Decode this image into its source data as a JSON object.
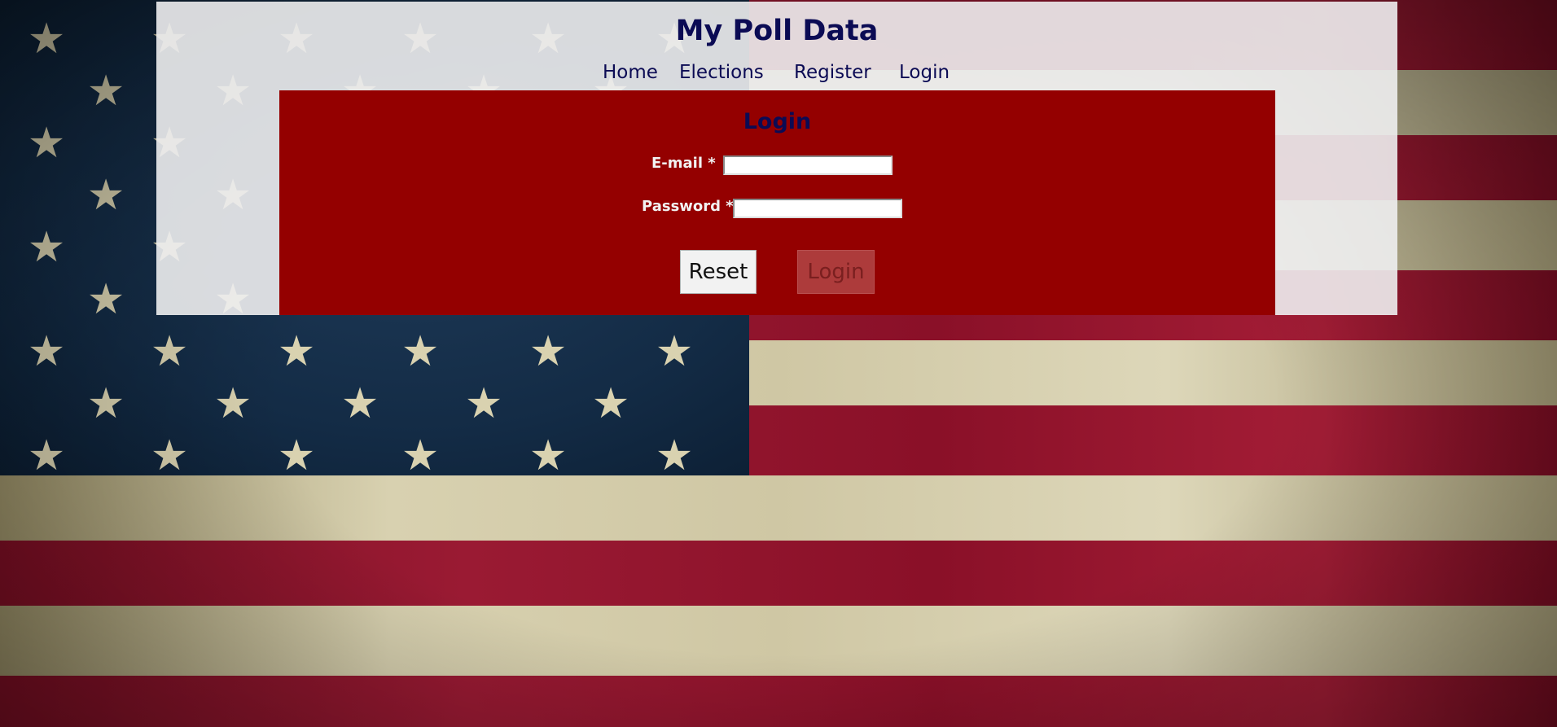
{
  "site": {
    "title": "My Poll Data"
  },
  "nav": {
    "items": [
      {
        "label": "Home"
      },
      {
        "label": "Elections"
      },
      {
        "label": "Register"
      },
      {
        "label": "Login"
      }
    ]
  },
  "login_form": {
    "title": "Login",
    "email": {
      "label": "E-mail *",
      "value": "",
      "placeholder": ""
    },
    "password": {
      "label": "Password *",
      "value": "",
      "placeholder": ""
    },
    "reset_label": "Reset",
    "login_label": "Login",
    "login_disabled": true
  },
  "colors": {
    "header_text": "#0b0b54",
    "form_background": "#940000",
    "panel_background": "#eeeef0"
  },
  "background": {
    "description_icon": "us-flag-image"
  }
}
